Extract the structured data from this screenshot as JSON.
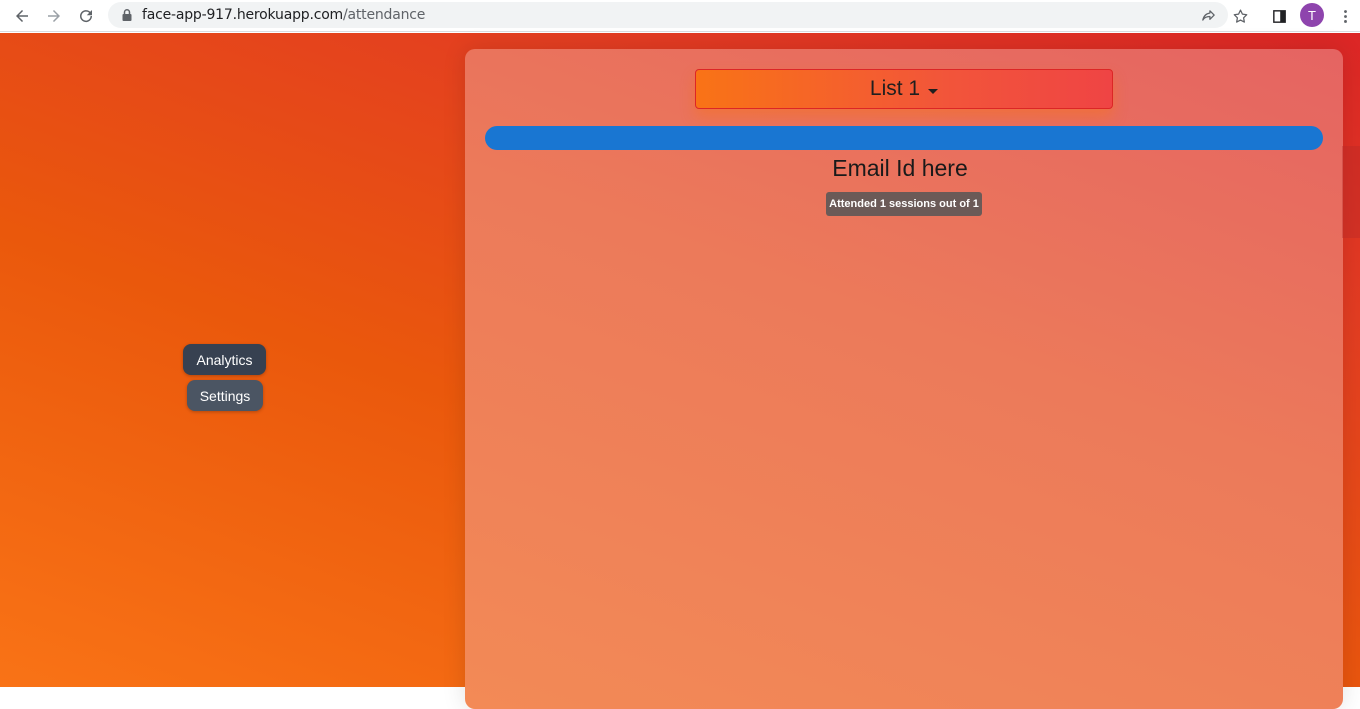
{
  "browser": {
    "url_host": "face-app-917.herokuapp.com",
    "url_path": "/attendance",
    "profile_initial": "T"
  },
  "side_nav": {
    "items": [
      {
        "label": "Analytics"
      },
      {
        "label": "Settings"
      }
    ]
  },
  "main": {
    "list_select": {
      "label": "List 1"
    },
    "student": {
      "email_label": "Email Id here",
      "attendance_text": "Attended 1 sessions out of 1"
    }
  },
  "colors": {
    "student_bar": "#1976d2",
    "nav_analytics": "#374151",
    "nav_settings": "#4b5563"
  }
}
